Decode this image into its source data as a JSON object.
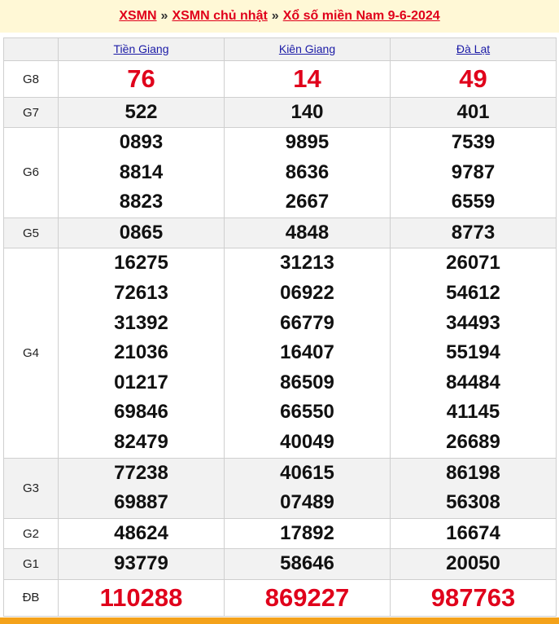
{
  "breadcrumb": {
    "home": "XSMN",
    "sep1": "»",
    "day": "XSMN chủ nhật",
    "sep2": "»",
    "title": "Xổ số miền Nam 9-6-2024"
  },
  "provinces": [
    "Tiền Giang",
    "Kiên Giang",
    "Đà Lạt"
  ],
  "prizes": [
    {
      "label": "G8",
      "style": "big",
      "numbers": [
        [
          "76"
        ],
        [
          "14"
        ],
        [
          "49"
        ]
      ]
    },
    {
      "label": "G7",
      "style": "normal",
      "numbers": [
        [
          "522"
        ],
        [
          "140"
        ],
        [
          "401"
        ]
      ]
    },
    {
      "label": "G6",
      "style": "normal",
      "numbers": [
        [
          "0893",
          "8814",
          "8823"
        ],
        [
          "9895",
          "8636",
          "2667"
        ],
        [
          "7539",
          "9787",
          "6559"
        ]
      ]
    },
    {
      "label": "G5",
      "style": "normal",
      "numbers": [
        [
          "0865"
        ],
        [
          "4848"
        ],
        [
          "8773"
        ]
      ]
    },
    {
      "label": "G4",
      "style": "normal",
      "numbers": [
        [
          "16275",
          "72613",
          "31392",
          "21036",
          "01217",
          "69846",
          "82479"
        ],
        [
          "31213",
          "06922",
          "66779",
          "16407",
          "86509",
          "66550",
          "40049"
        ],
        [
          "26071",
          "54612",
          "34493",
          "55194",
          "84484",
          "41145",
          "26689"
        ]
      ]
    },
    {
      "label": "G3",
      "style": "normal",
      "numbers": [
        [
          "77238",
          "69887"
        ],
        [
          "40615",
          "07489"
        ],
        [
          "86198",
          "56308"
        ]
      ]
    },
    {
      "label": "G2",
      "style": "normal",
      "numbers": [
        [
          "48624"
        ],
        [
          "17892"
        ],
        [
          "16674"
        ]
      ]
    },
    {
      "label": "G1",
      "style": "normal",
      "numbers": [
        [
          "93779"
        ],
        [
          "58646"
        ],
        [
          "20050"
        ]
      ]
    },
    {
      "label": "ĐB",
      "style": "big",
      "numbers": [
        [
          "110288"
        ],
        [
          "869227"
        ],
        [
          "987763"
        ]
      ]
    }
  ],
  "colors": {
    "red": "#e0001b",
    "link_blue": "#1a1aa6",
    "row_grey": "#f2f2f2",
    "banner": "#fff8d6",
    "footer_orange": "#f4a21a"
  }
}
